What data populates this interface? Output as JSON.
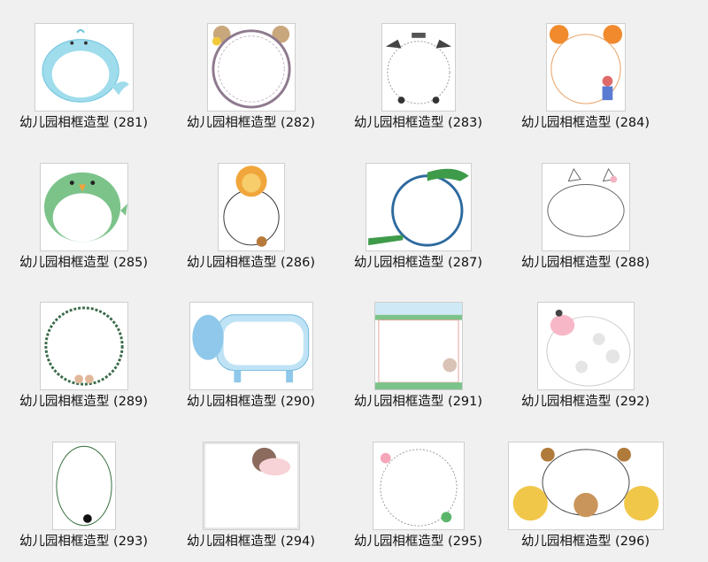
{
  "window": {
    "view": "large-icons"
  },
  "items": [
    {
      "name": "幼儿园相框造型 (281)",
      "icon": "whale-frame"
    },
    {
      "name": "幼儿园相框造型 (282)",
      "icon": "bear-circle-frame"
    },
    {
      "name": "幼儿园相框造型 (283)",
      "icon": "cow-circle-frame"
    },
    {
      "name": "幼儿园相框造型 (284)",
      "icon": "orange-bear-frame"
    },
    {
      "name": "幼儿园相框造型 (285)",
      "icon": "green-bird-frame"
    },
    {
      "name": "幼儿园相框造型 (286)",
      "icon": "lion-frame"
    },
    {
      "name": "幼儿园相框造型 (287)",
      "icon": "crocodile-frame"
    },
    {
      "name": "幼儿园相框造型 (288)",
      "icon": "cat-cloud-frame"
    },
    {
      "name": "幼儿园相框造型 (289)",
      "icon": "leaf-circle-frame"
    },
    {
      "name": "幼儿园相框造型 (290)",
      "icon": "blue-elephant-frame"
    },
    {
      "name": "幼儿园相框造型 (291)",
      "icon": "grass-rectangle-frame"
    },
    {
      "name": "幼儿园相框造型 (292)",
      "icon": "spotted-cow-frame"
    },
    {
      "name": "幼儿园相框造型 (293)",
      "icon": "oval-cat-frame"
    },
    {
      "name": "幼儿园相框造型 (294)",
      "icon": "snail-frame"
    },
    {
      "name": "幼儿园相框造型 (295)",
      "icon": "butterfly-circle-frame"
    },
    {
      "name": "幼儿园相框造型 (296)",
      "icon": "three-bears-frame"
    }
  ]
}
